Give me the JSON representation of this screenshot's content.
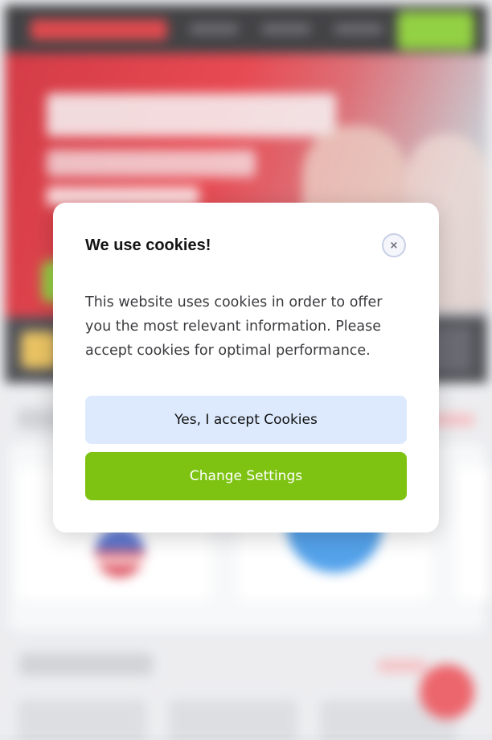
{
  "cookie_modal": {
    "title": "We use cookies!",
    "close_icon": "×",
    "body": "This website uses cookies in order to offer you the most relevant information. Please accept cookies for optimal performance.",
    "accept_label": "Yes, I accept Cookies",
    "settings_label": "Change Settings"
  },
  "colors": {
    "accept_button_bg": "#ddeafd",
    "settings_button_bg": "#7ec312",
    "brand_red": "#d92228"
  }
}
